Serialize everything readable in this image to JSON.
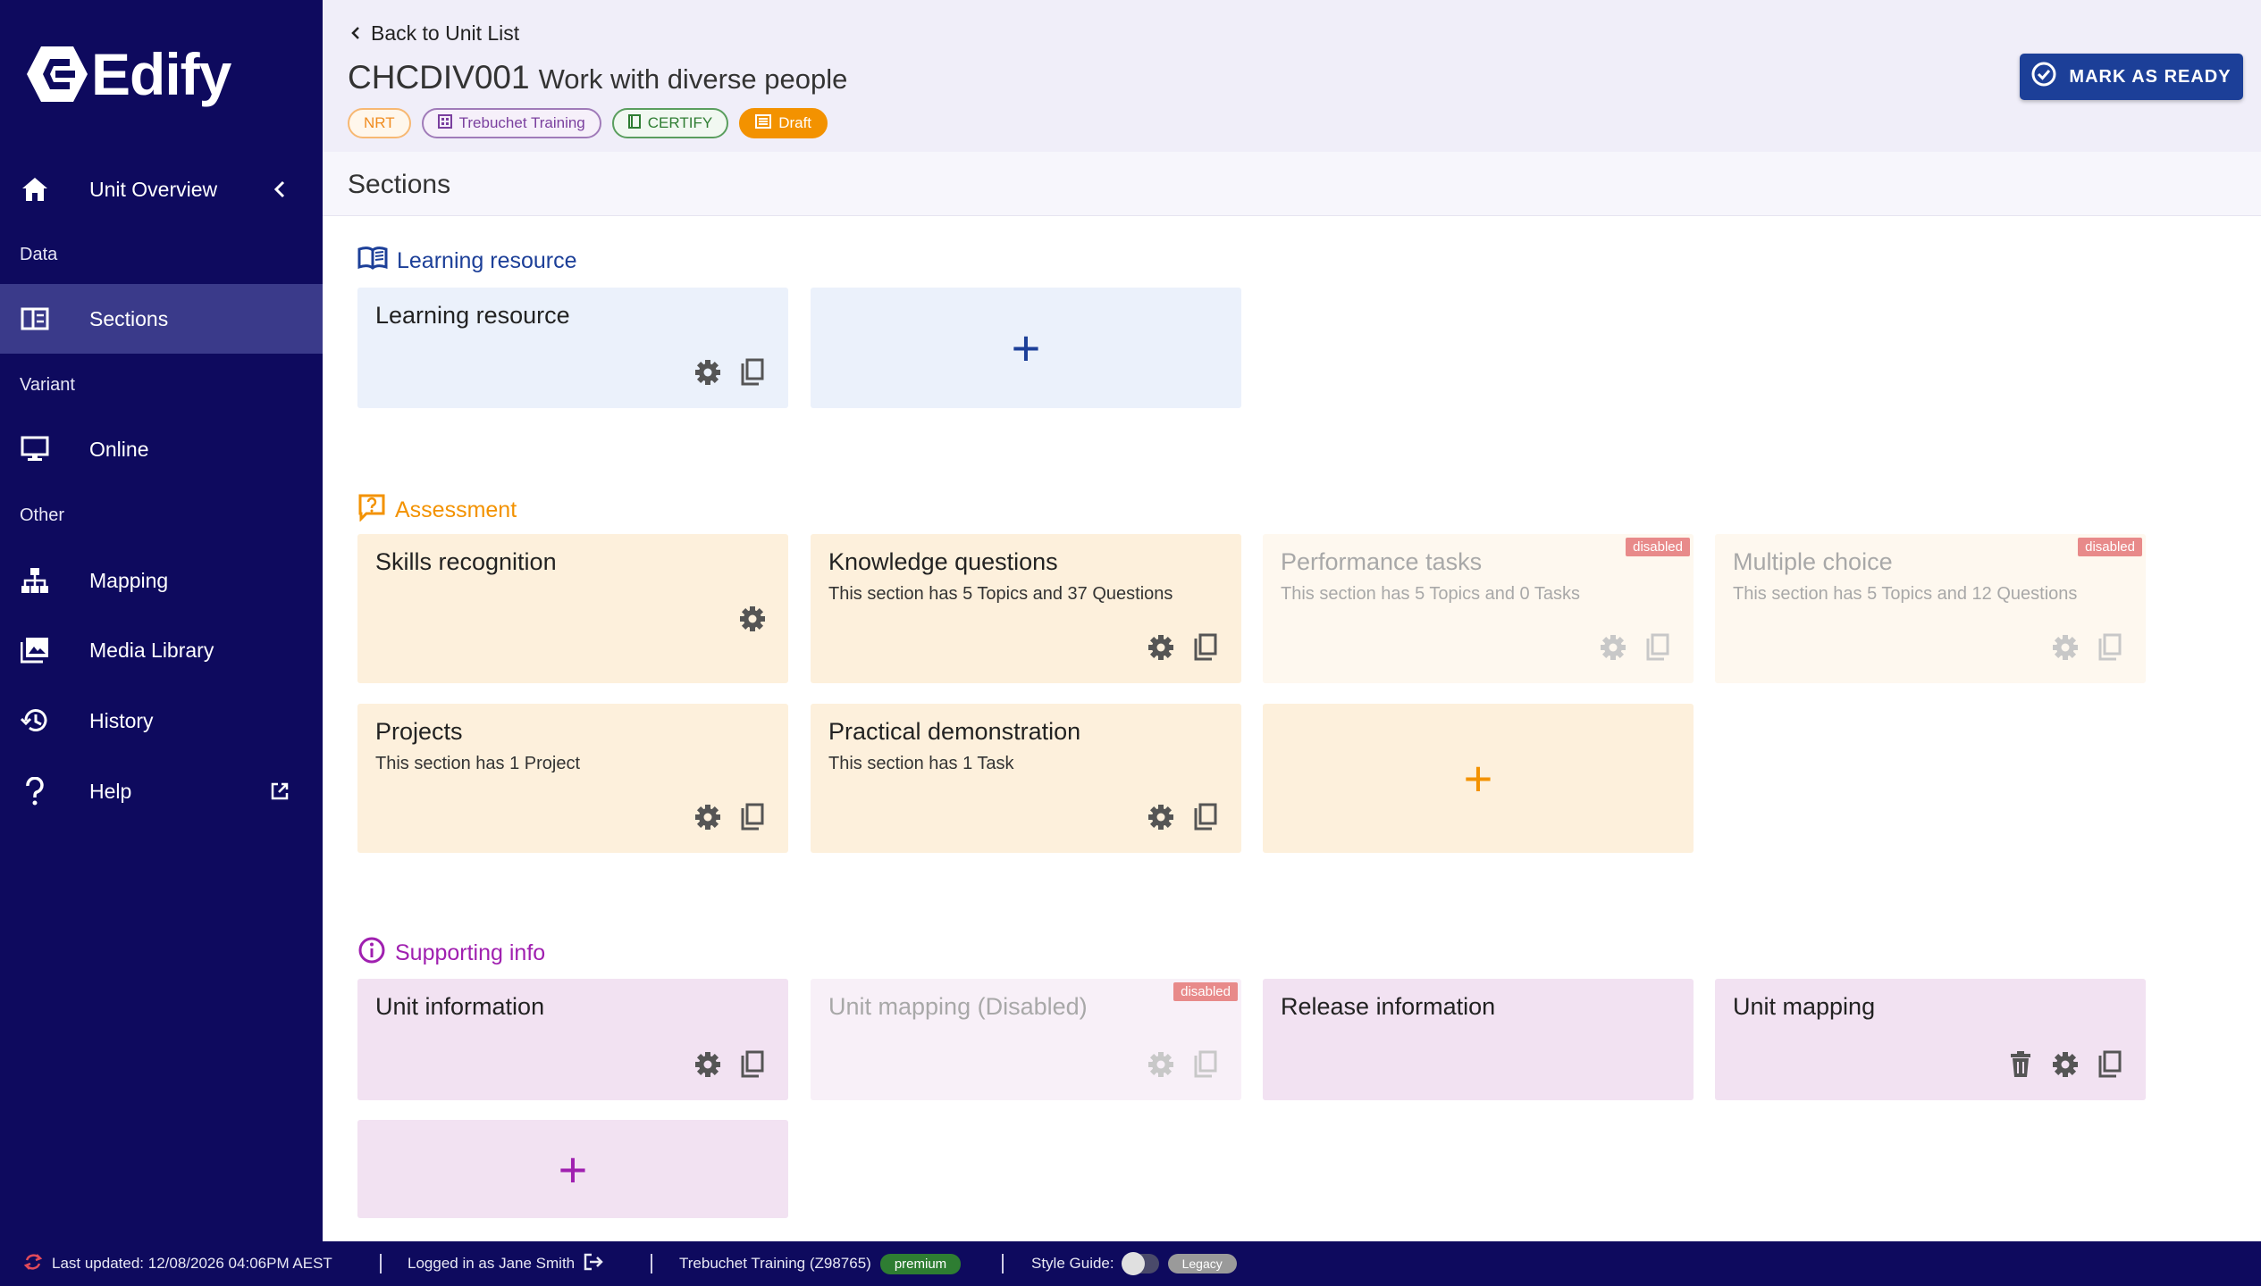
{
  "app": {
    "name": "Edify"
  },
  "sidebar": {
    "items": [
      {
        "label": "Unit Overview",
        "icon": "home-icon"
      },
      {
        "label": "Sections",
        "icon": "sections-icon"
      },
      {
        "label": "Online",
        "icon": "monitor-icon"
      },
      {
        "label": "Mapping",
        "icon": "sitemap-icon"
      },
      {
        "label": "Media Library",
        "icon": "image-icon"
      },
      {
        "label": "History",
        "icon": "history-icon"
      },
      {
        "label": "Help",
        "icon": "help-icon"
      }
    ],
    "groups": {
      "data": "Data",
      "variant": "Variant",
      "other": "Other"
    }
  },
  "header": {
    "back_label": "Back to Unit List",
    "unit_code": "CHCDIV001",
    "unit_name": "Work with diverse people",
    "badges": {
      "nrt": "NRT",
      "org": "Trebuchet Training",
      "cert": "CERTIFY",
      "status": "Draft"
    },
    "ready_button": "MARK AS READY"
  },
  "page": {
    "title": "Sections"
  },
  "groups": {
    "learning": {
      "title": "Learning resource",
      "color": "#1c3f98",
      "cards": [
        {
          "title": "Learning resource"
        }
      ]
    },
    "assessment": {
      "title": "Assessment",
      "color": "#f39200",
      "cards": [
        {
          "title": "Skills recognition",
          "sub": ""
        },
        {
          "title": "Knowledge questions",
          "sub": "This section has 5 Topics and 37 Questions"
        },
        {
          "title": "Performance tasks",
          "sub": "This section has 5 Topics and 0 Tasks",
          "tag": "disabled"
        },
        {
          "title": "Multiple choice",
          "sub": "This section has 5 Topics and 12 Questions",
          "tag": "disabled"
        },
        {
          "title": "Projects",
          "sub": "This section has 1 Project"
        },
        {
          "title": "Practical demonstration",
          "sub": "This section has 1 Task"
        }
      ]
    },
    "supporting": {
      "title": "Supporting info",
      "color": "#a020b0",
      "cards": [
        {
          "title": "Unit information"
        },
        {
          "title": "Unit mapping (Disabled)",
          "tag": "disabled"
        },
        {
          "title": "Release information"
        },
        {
          "title": "Unit mapping"
        }
      ]
    }
  },
  "add_symbol": "+",
  "footer": {
    "last_updated": "Last updated: 12/08/2026 04:06PM AEST",
    "logged_in": "Logged in as Jane Smith",
    "org": "Trebuchet Training (Z98765)",
    "plan": "premium",
    "style_guide_label": "Style Guide:",
    "style_guide_value": "Legacy"
  }
}
